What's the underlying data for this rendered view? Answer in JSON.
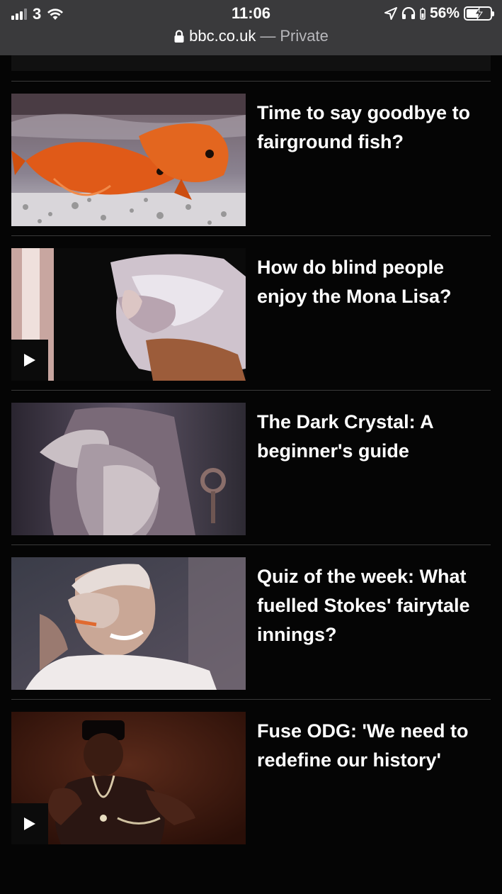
{
  "status_bar": {
    "carrier": "3",
    "time": "11:06",
    "battery_percent": "56%",
    "battery_level": 0.56,
    "icons": [
      "signal-icon",
      "wifi-icon",
      "location-icon",
      "headphones-icon",
      "battery-icon"
    ]
  },
  "address_bar": {
    "host": "bbc.co.uk",
    "separator": "—",
    "mode": "Private"
  },
  "articles": [
    {
      "headline": "Time to say goodbye to fairground fish?",
      "has_video": false,
      "thumb": "goldfish"
    },
    {
      "headline": "How do blind people enjoy the Mona Lisa?",
      "has_video": true,
      "thumb": "hand-touching-relief"
    },
    {
      "headline": "The Dark Crystal: A beginner's guide",
      "has_video": false,
      "thumb": "puppet-creature"
    },
    {
      "headline": "Quiz of the week: What fuelled Stokes' fairytale innings?",
      "has_video": false,
      "thumb": "cricketer-laughing"
    },
    {
      "headline": "Fuse ODG: 'We need to redefine our history'",
      "has_video": true,
      "thumb": "musician-performing"
    }
  ],
  "colors": {
    "background": "#050505",
    "status_bar": "#3a3a3c",
    "divider": "#3a3a3a",
    "text": "#ffffff"
  }
}
